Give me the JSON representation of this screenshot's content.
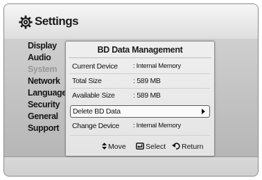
{
  "header": {
    "title": "Settings",
    "icon": "gear-icon"
  },
  "menu": {
    "items": [
      {
        "label": "Display",
        "dimmed": false
      },
      {
        "label": "Audio",
        "dimmed": false
      },
      {
        "label": "System",
        "dimmed": true
      },
      {
        "label": "Network",
        "dimmed": false
      },
      {
        "label": "Language",
        "dimmed": false
      },
      {
        "label": "Security",
        "dimmed": false
      },
      {
        "label": "General",
        "dimmed": false
      },
      {
        "label": "Support",
        "dimmed": false
      }
    ]
  },
  "dialog": {
    "title": "BD Data Management",
    "rows": [
      {
        "label": "Current Device",
        "value": ": Internal Memory"
      },
      {
        "label": "Total Size",
        "value": ": 589 MB"
      },
      {
        "label": "Available Size",
        "value": ": 589 MB"
      }
    ],
    "actions": [
      {
        "label": "Delete BD Data",
        "value": "",
        "selected": true
      },
      {
        "label": "Change Device",
        "value": ": Internal Memory",
        "selected": false
      }
    ],
    "footer": {
      "move": {
        "label": "Move",
        "icon": "up-down-arrows-icon"
      },
      "select": {
        "label": "Select",
        "icon": "enter-icon"
      },
      "return": {
        "label": "Return",
        "icon": "return-icon"
      }
    }
  },
  "colors": {
    "selection_border": "#5a5a5a",
    "dimmed_text": "#9a9a9a"
  }
}
